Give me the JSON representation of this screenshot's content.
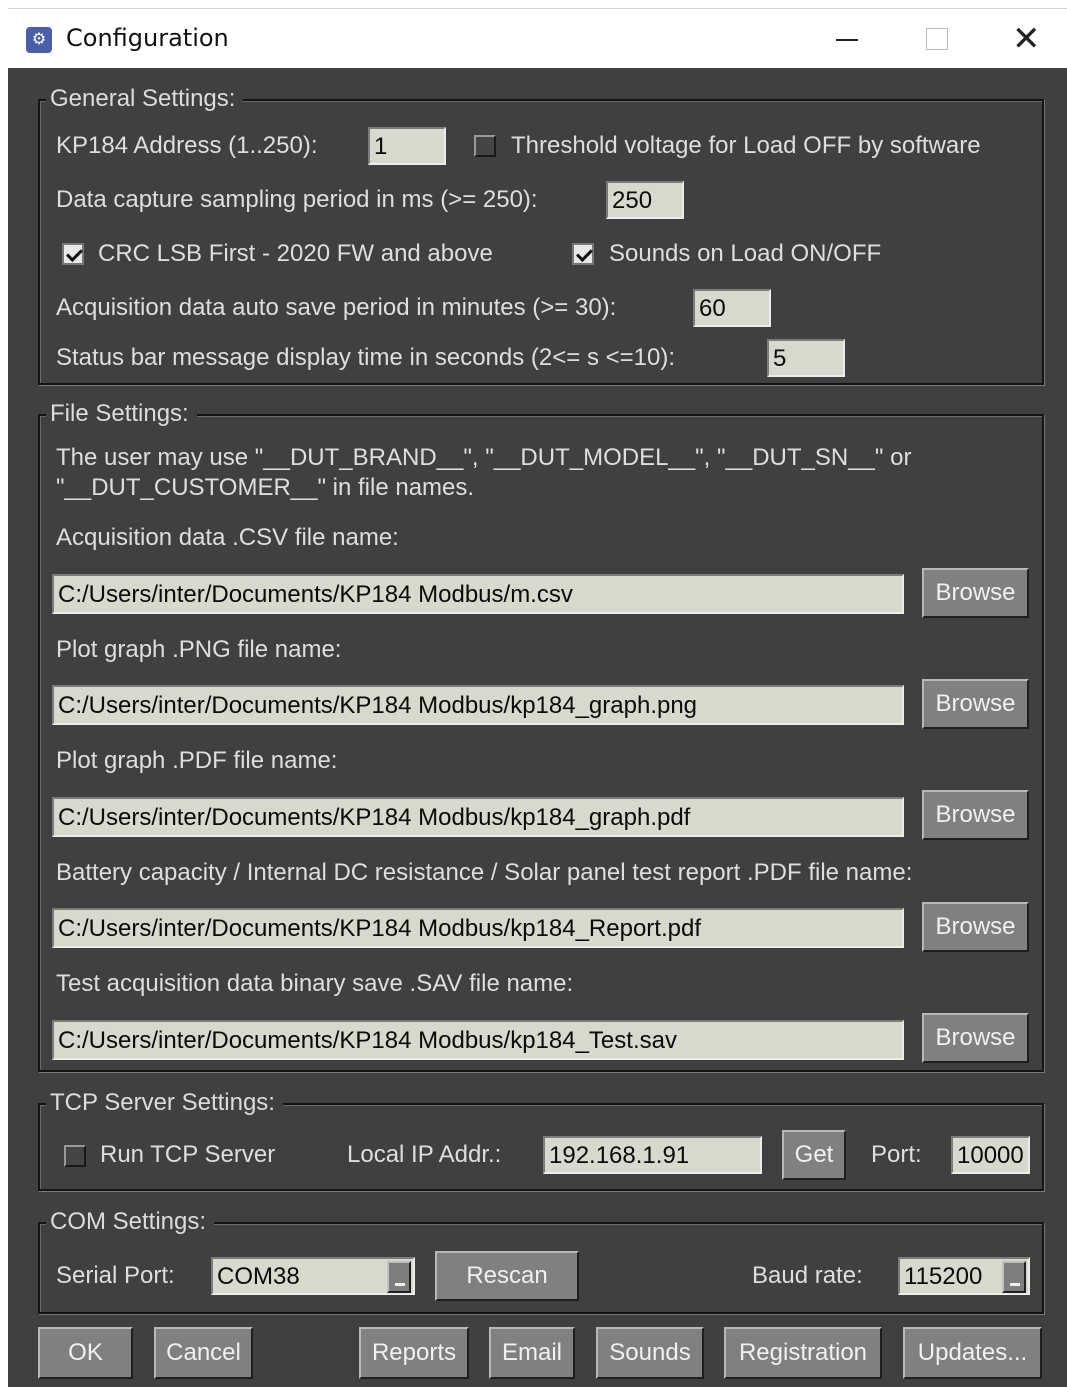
{
  "window": {
    "title": "Configuration",
    "icon": "gear-icon"
  },
  "general": {
    "title": "General Settings:",
    "address_label": "KP184 Address (1..250):",
    "address_value": "1",
    "threshold_label": "Threshold voltage for Load OFF by software",
    "threshold_checked": false,
    "sampling_label": "Data capture sampling period in ms (>= 250):",
    "sampling_value": "250",
    "crc_label": "CRC LSB First - 2020 FW and above",
    "crc_checked": true,
    "sounds_label": "Sounds on Load ON/OFF",
    "sounds_checked": true,
    "autosave_label": "Acquisition data auto save period in minutes (>= 30):",
    "autosave_value": "60",
    "statusbar_label": "Status bar message display time in seconds (2<= s <=10):",
    "statusbar_value": "5"
  },
  "file": {
    "title": "File Settings:",
    "note_line1": "The user may use \"__DUT_BRAND__\", \"__DUT_MODEL__\", \"__DUT_SN__\" or",
    "note_line2": "\"__DUT_CUSTOMER__\" in file names.",
    "browse_label": "Browse",
    "entries": [
      {
        "label": "Acquisition data .CSV file name:",
        "value": "C:/Users/inter/Documents/KP184 Modbus/m.csv"
      },
      {
        "label": "Plot graph .PNG file name:",
        "value": "C:/Users/inter/Documents/KP184 Modbus/kp184_graph.png"
      },
      {
        "label": "Plot graph .PDF file name:",
        "value": "C:/Users/inter/Documents/KP184 Modbus/kp184_graph.pdf"
      },
      {
        "label": "Battery capacity / Internal DC resistance / Solar panel test report .PDF file name:",
        "value": "C:/Users/inter/Documents/KP184 Modbus/kp184_Report.pdf"
      },
      {
        "label": "Test acquisition data binary save .SAV file name:",
        "value": "C:/Users/inter/Documents/KP184 Modbus/kp184_Test.sav"
      }
    ]
  },
  "tcp": {
    "title": "TCP Server Settings:",
    "run_label": "Run TCP Server",
    "run_checked": false,
    "ip_label": "Local IP Addr.:",
    "ip_value": "192.168.1.91",
    "get_label": "Get",
    "port_label": "Port:",
    "port_value": "10000"
  },
  "com": {
    "title": "COM Settings:",
    "serial_label": "Serial Port:",
    "serial_value": "COM38",
    "rescan_label": "Rescan",
    "baud_label": "Baud rate:",
    "baud_value": "115200"
  },
  "footer": {
    "ok": "OK",
    "cancel": "Cancel",
    "reports": "Reports",
    "email": "Email",
    "sounds": "Sounds",
    "registration": "Registration",
    "updates": "Updates..."
  },
  "colors": {
    "background": "#404040",
    "field": "#d8d8cc",
    "button": "#808080",
    "text": "#dedede"
  }
}
